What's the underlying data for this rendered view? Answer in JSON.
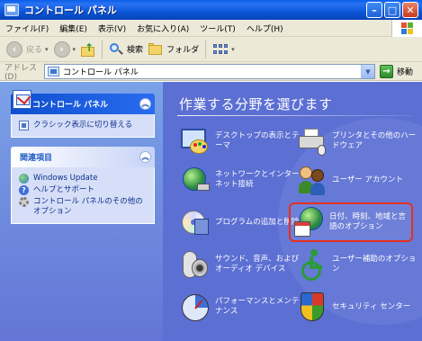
{
  "window": {
    "title": "コントロール パネル",
    "minimize": "–",
    "maximize": "□",
    "close": "✕"
  },
  "menu": {
    "items": [
      "ファイル(F)",
      "編集(E)",
      "表示(V)",
      "お気に入り(A)",
      "ツール(T)",
      "ヘルプ(H)"
    ]
  },
  "toolbar": {
    "back_label": "戻る",
    "search_label": "検索",
    "folders_label": "フォルダ"
  },
  "address": {
    "label": "アドレス(D)",
    "value": "コントロール パネル",
    "go_label": "移動"
  },
  "sidebar": {
    "control_panel": {
      "title": "コントロール パネル",
      "switch_view": "クラシック表示に切り替える"
    },
    "see_also": {
      "title": "関連項目",
      "links": [
        "Windows Update",
        "ヘルプとサポート",
        "コントロール パネルのその他のオプション"
      ]
    }
  },
  "main": {
    "heading": "作業する分野を選びます",
    "categories": [
      {
        "label": "デスクトップの表示とテーマ",
        "icon": "appearance-themes-icon"
      },
      {
        "label": "プリンタとその他のハードウェア",
        "icon": "printers-hardware-icon"
      },
      {
        "label": "ネットワークとインターネット接続",
        "icon": "network-internet-icon"
      },
      {
        "label": "ユーザー アカウント",
        "icon": "user-accounts-icon"
      },
      {
        "label": "プログラムの追加と削除",
        "icon": "add-remove-programs-icon"
      },
      {
        "label": "日付、時刻、地域と言語のオプション",
        "icon": "date-time-language-icon"
      },
      {
        "label": "サウンド、音声、およびオーディオ デバイス",
        "icon": "sounds-audio-icon"
      },
      {
        "label": "ユーザー補助のオプション",
        "icon": "accessibility-icon"
      },
      {
        "label": "パフォーマンスとメンテナンス",
        "icon": "performance-maintenance-icon"
      },
      {
        "label": "セキュリティ センター",
        "icon": "security-center-icon"
      }
    ],
    "selected_index": 5
  },
  "colors": {
    "title_bar": "#0b55d8",
    "main_background": "#5c6fd3",
    "selection_outline": "#e53020"
  }
}
